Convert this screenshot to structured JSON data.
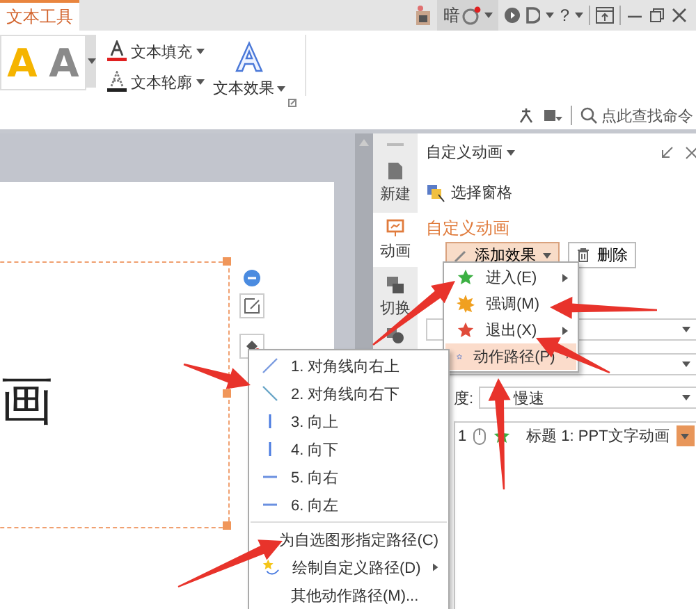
{
  "ribbon_tab": {
    "label": "文本工具",
    "selected": true
  },
  "title_bar": {
    "theme_label": "暗",
    "help": "?"
  },
  "ribbon": {
    "styles": [
      {
        "letter": "A",
        "kind": "gold"
      },
      {
        "letter": "A",
        "kind": "gray"
      }
    ],
    "commands": [
      {
        "label": "文本填充",
        "kind": "fill"
      },
      {
        "label": "文本轮廓",
        "kind": "outline"
      }
    ],
    "effect": {
      "label": "文本效果"
    }
  },
  "search": {
    "placeholder": "点此查找命令"
  },
  "slide": {
    "text": "画"
  },
  "side_tabs": [
    {
      "label": "新建",
      "kind": "new",
      "selected": false
    },
    {
      "label": "动画",
      "kind": "animation",
      "selected": true
    },
    {
      "label": "切换",
      "kind": "switch",
      "selected": false
    }
  ],
  "pane": {
    "title": "自定义动画",
    "select_pane": "选择窗格",
    "section": "自定义动画",
    "add_button": "添加效果",
    "delete_button": "删除",
    "speed_label": "度:",
    "speed_value": "慢速",
    "list": [
      {
        "index": "1",
        "label": "标题 1: PPT文字动画"
      }
    ]
  },
  "effect_menu": [
    {
      "label": "进入(E)",
      "kind": "enter",
      "submenu": true,
      "selected": false
    },
    {
      "label": "强调(M)",
      "kind": "emphasis",
      "submenu": false,
      "selected": false
    },
    {
      "label": "退出(X)",
      "kind": "exit",
      "submenu": true,
      "selected": false
    },
    {
      "label": "动作路径(P)",
      "kind": "path",
      "submenu": true,
      "selected": true
    }
  ],
  "path_menu": [
    {
      "label": "1. 对角线向右上",
      "kind": "diag-up"
    },
    {
      "label": "2. 对角线向右下",
      "kind": "diag-down"
    },
    {
      "label": "3. 向上",
      "kind": "vertical"
    },
    {
      "label": "4. 向下",
      "kind": "vertical"
    },
    {
      "label": "5. 向右",
      "kind": "horizontal"
    },
    {
      "label": "6. 向左",
      "kind": "horizontal"
    },
    {
      "label": "为自选图形指定路径(C)",
      "kind": "plain",
      "divider_before": true
    },
    {
      "label": "绘制自定义路径(D)",
      "kind": "custom",
      "submenu": true
    },
    {
      "label": "其他动作路径(M)...",
      "kind": "plain"
    }
  ]
}
